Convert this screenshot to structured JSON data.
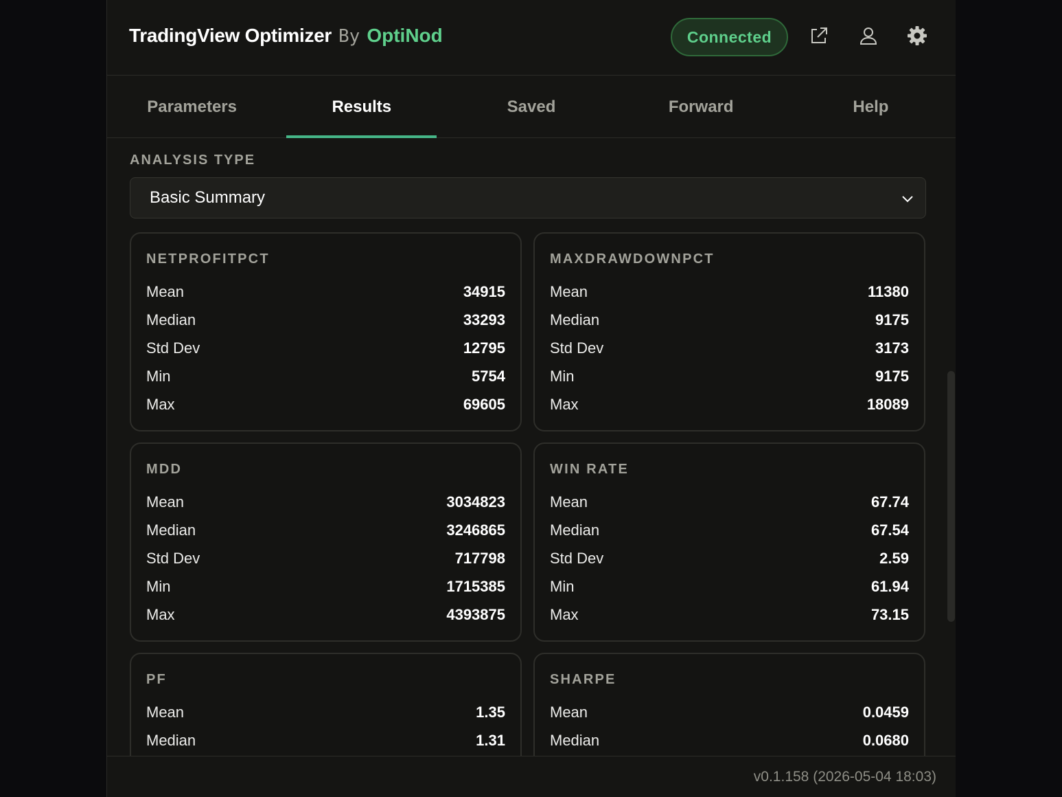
{
  "header": {
    "app_name": "TradingView Optimizer",
    "by": "By",
    "company": "OptiNod",
    "status": "Connected",
    "icons": [
      "external-link-icon",
      "user-icon",
      "gear-icon"
    ]
  },
  "tabs": [
    {
      "label": "Parameters",
      "active": false
    },
    {
      "label": "Results",
      "active": true
    },
    {
      "label": "Saved",
      "active": false
    },
    {
      "label": "Forward",
      "active": false
    },
    {
      "label": "Help",
      "active": false
    }
  ],
  "analysis": {
    "label": "ANALYSIS TYPE",
    "selected": "Basic Summary"
  },
  "row_labels": {
    "mean": "Mean",
    "median": "Median",
    "std": "Std Dev",
    "min": "Min",
    "max": "Max"
  },
  "cards": [
    {
      "title": "NETPROFITPCT",
      "mean": "34915",
      "median": "33293",
      "std": "12795",
      "min": "5754",
      "max": "69605"
    },
    {
      "title": "MAXDRAWDOWNPCT",
      "mean": "11380",
      "median": "9175",
      "std": "3173",
      "min": "9175",
      "max": "18089"
    },
    {
      "title": "MDD",
      "mean": "3034823",
      "median": "3246865",
      "std": "717798",
      "min": "1715385",
      "max": "4393875"
    },
    {
      "title": "WIN RATE",
      "mean": "67.74",
      "median": "67.54",
      "std": "2.59",
      "min": "61.94",
      "max": "73.15"
    },
    {
      "title": "PF",
      "mean": "1.35",
      "median": "1.31"
    },
    {
      "title": "SHARPE",
      "mean": "0.0459",
      "median": "0.0680"
    }
  ],
  "footer": {
    "version": "v0.1.158 (2026-05-04 18:03)"
  },
  "colors": {
    "accent": "#5fd08c",
    "tab_underline": "#46b688",
    "background": "#151513"
  }
}
